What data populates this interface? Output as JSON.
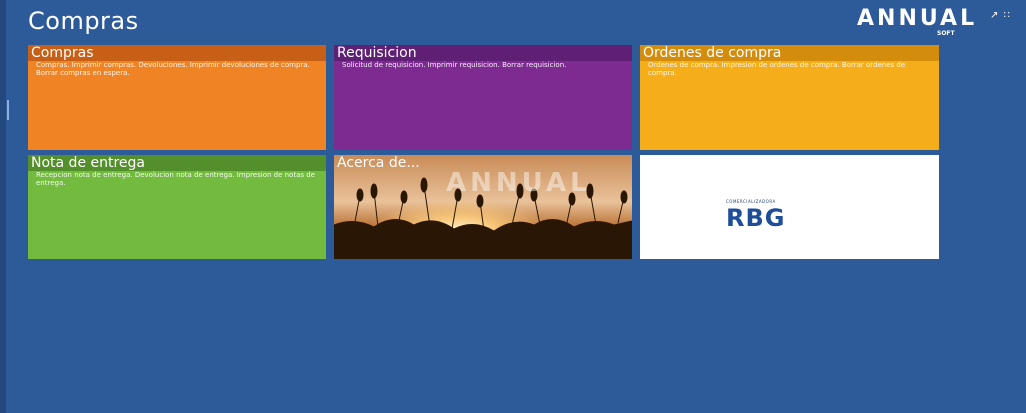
{
  "header": {
    "title": "Compras",
    "brand_name": "ANNUAL",
    "brand_sub": "SOFT",
    "controls": [
      "↗",
      "∷"
    ]
  },
  "tiles": [
    {
      "id": "compras",
      "title": "Compras",
      "desc": "Compras. Imprimir compras. Devoluciones. Imprimir devoluciones de compra. Borrar compras en espera.",
      "color": "#f08424"
    },
    {
      "id": "requisicion",
      "title": "Requisicion",
      "desc": "Solicitud de requisicion. Imprimir requisicion. Borrar requisicion.",
      "color": "#7d2a91"
    },
    {
      "id": "ordenes",
      "title": "Ordenes de compra",
      "desc": "Ordenes de compra. Impresion de ordenes de compra. Borrar ordenes de compra.",
      "color": "#f6ad1a"
    },
    {
      "id": "nota",
      "title": "Nota de entrega",
      "desc": "Recepcion nota de entrega. Devolucion nota de entrega. Impresion de notas de entrega.",
      "color": "#72bb3e"
    },
    {
      "id": "acerca",
      "title": "Acerca de...",
      "image_text": "ANNUAL",
      "color": "#5a3415"
    },
    {
      "id": "rbg",
      "logo_text": "RBG",
      "logo_small": "COMERCIALIZADORA",
      "color": "#ffffff"
    }
  ],
  "colors": {
    "background": "#2d5a99"
  }
}
